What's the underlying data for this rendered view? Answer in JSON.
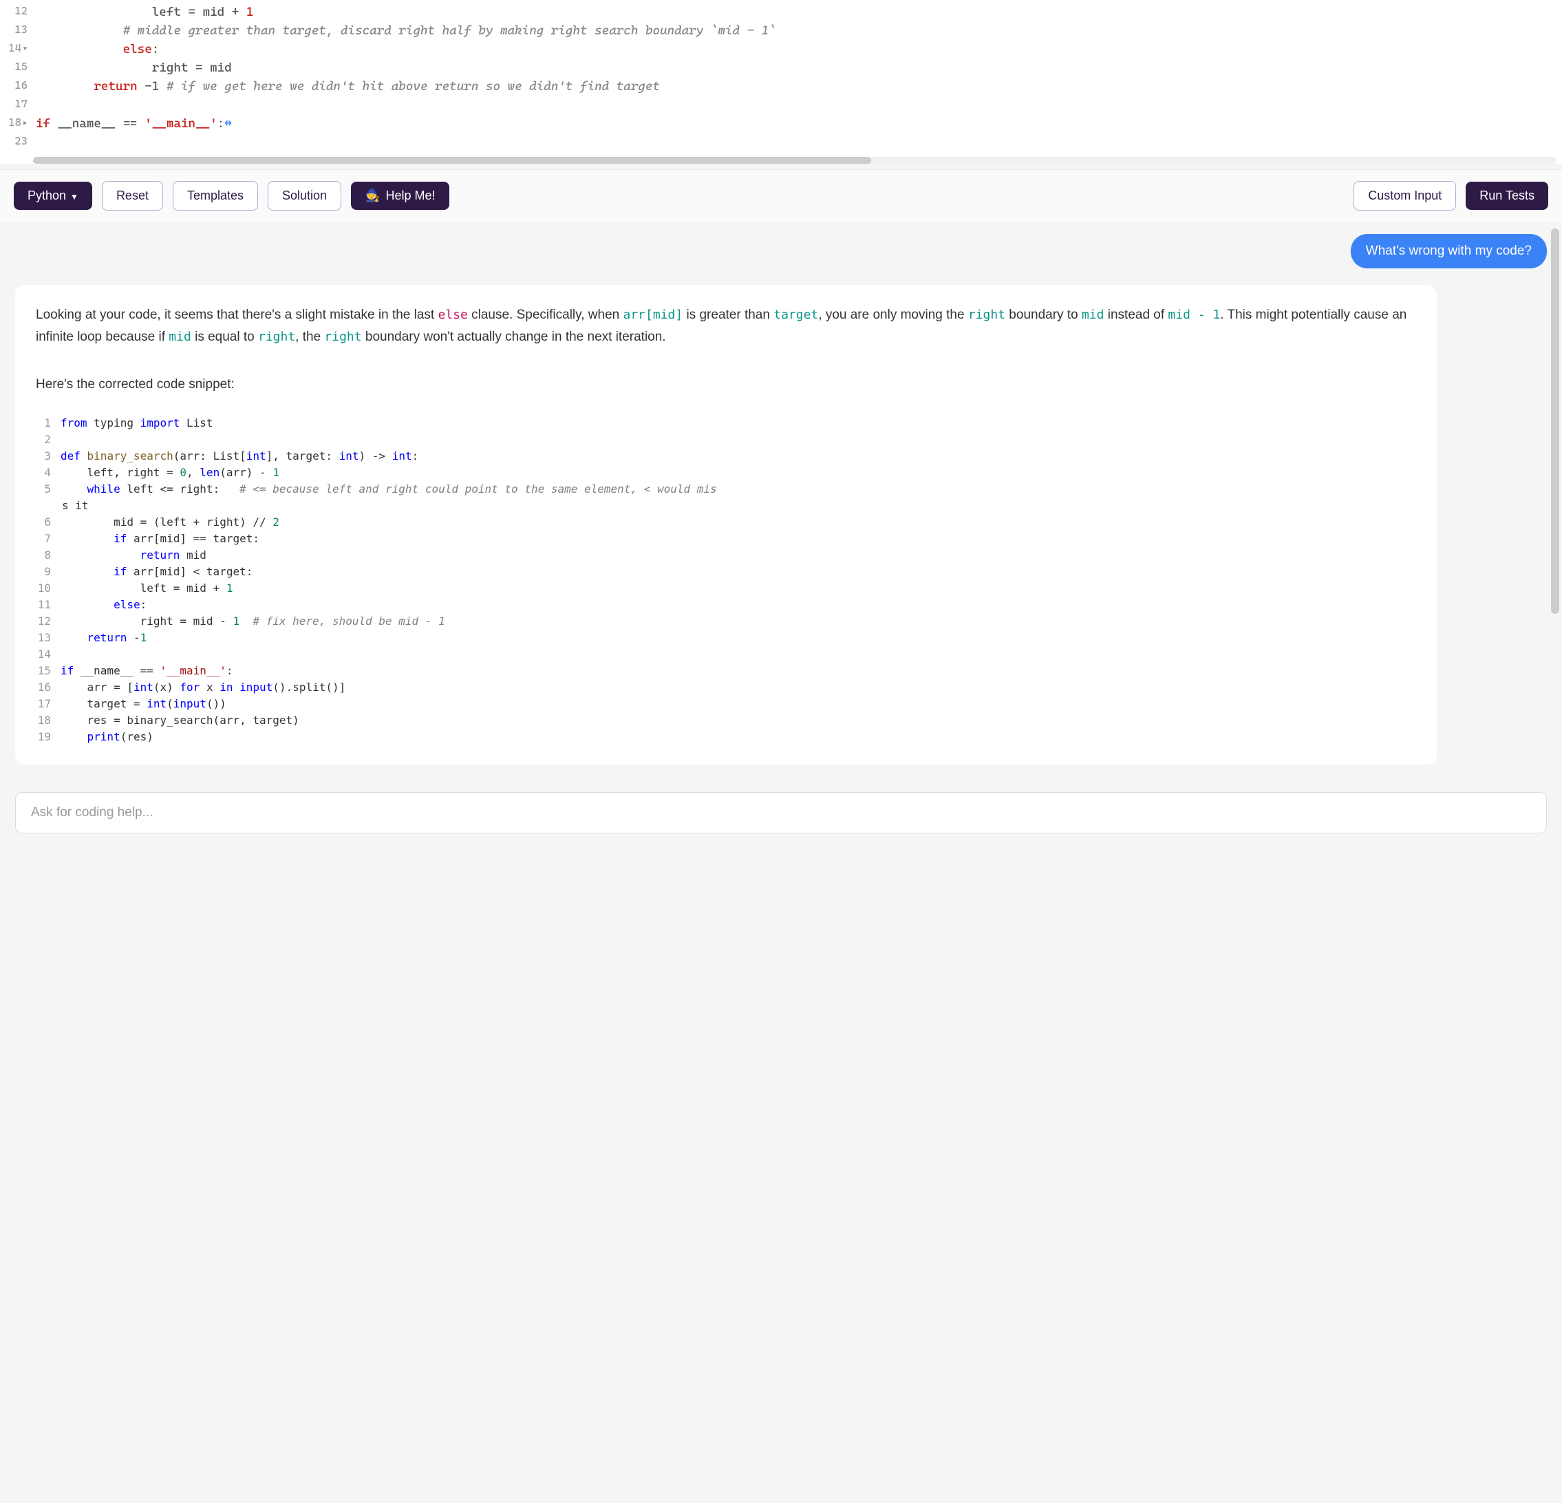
{
  "editor": {
    "lines": [
      {
        "n": 12,
        "marker": ""
      },
      {
        "n": 13,
        "marker": ""
      },
      {
        "n": 14,
        "marker": "▾"
      },
      {
        "n": 15,
        "marker": ""
      },
      {
        "n": 16,
        "marker": ""
      },
      {
        "n": 17,
        "marker": ""
      },
      {
        "n": 18,
        "marker": "▸"
      },
      {
        "n": 23,
        "marker": ""
      }
    ],
    "code": {
      "l12_indent": "                ",
      "l12_a": "left = mid + ",
      "l12_b": "1",
      "l13_indent": "            ",
      "l13": "# middle greater than target, discard right half by making right search boundary `mid - 1`",
      "l14_indent": "            ",
      "l14_a": "else",
      "l14_b": ":",
      "l15_indent": "                ",
      "l15": "right = mid",
      "l16_indent": "        ",
      "l16_a": "return",
      "l16_b": " -1 ",
      "l16_c": "# if we get here we didn't hit above return so we didn't find target",
      "l18_a": "if",
      "l18_b": " __name__ == ",
      "l18_c": "'__main__'",
      "l18_d": ":",
      "l18_fold": "↔"
    }
  },
  "toolbar": {
    "language": "Python",
    "reset": "Reset",
    "templates": "Templates",
    "solution": "Solution",
    "help": "Help Me!",
    "help_emoji": "🧙",
    "custom_input": "Custom Input",
    "run_tests": "Run Tests"
  },
  "chat": {
    "user_msg": "What's wrong with my code?",
    "expl_part1": "Looking at your code, it seems that there's a slight mistake in the last ",
    "expl_else": "else",
    "expl_part2": " clause. Specifically, when ",
    "expl_arrmid": "arr[mid]",
    "expl_part3": " is greater than ",
    "expl_target": "target",
    "expl_part4": ", you are only moving the ",
    "expl_right": "right",
    "expl_part5": " boundary to ",
    "expl_mid": "mid",
    "expl_part6": " instead of ",
    "expl_midm1": "mid - 1",
    "expl_part7": ". This might potentially cause an infinite loop because if ",
    "expl_mid2": "mid",
    "expl_part8": " is equal to ",
    "expl_right2": "right",
    "expl_part9": ", the ",
    "expl_right3": "right",
    "expl_part10": " boundary won't actually change in the next iteration.",
    "expl_snippet_intro": "Here's the corrected code snippet:",
    "snippet_lines": [
      "1",
      "2",
      "3",
      "4",
      "5",
      "",
      "6",
      "7",
      "8",
      "9",
      "10",
      "11",
      "12",
      "13",
      "14",
      "15",
      "16",
      "17",
      "18",
      "19"
    ],
    "snippet_wrap_text": "s it",
    "s1_a": "from",
    "s1_b": " typing ",
    "s1_c": "import",
    "s1_d": " List",
    "s3_a": "def",
    "s3_b": " binary_search",
    "s3_c": "(arr: List[",
    "s3_d": "int",
    "s3_e": "], target: ",
    "s3_f": "int",
    "s3_g": ") -> ",
    "s3_h": "int",
    "s3_i": ":",
    "s4_a": "    left, right = ",
    "s4_b": "0",
    "s4_c": ", ",
    "s4_d": "len",
    "s4_e": "(arr) - ",
    "s4_f": "1",
    "s5_a": "    ",
    "s5_b": "while",
    "s5_c": " left <= right:   ",
    "s5_d": "# <= because left and right could point to the same element, < would mis",
    "s6_a": "        mid = (left + right) // ",
    "s6_b": "2",
    "s7_a": "        ",
    "s7_b": "if",
    "s7_c": " arr[mid] == target:",
    "s8_a": "            ",
    "s8_b": "return",
    "s8_c": " mid",
    "s9_a": "        ",
    "s9_b": "if",
    "s9_c": " arr[mid] < target:",
    "s10_a": "            left = mid + ",
    "s10_b": "1",
    "s11_a": "        ",
    "s11_b": "else",
    "s11_c": ":",
    "s12_a": "            right = mid - ",
    "s12_b": "1",
    "s12_c": "  ",
    "s12_d": "# fix here, should be mid - 1",
    "s13_a": "    ",
    "s13_b": "return",
    "s13_c": " -",
    "s13_d": "1",
    "s15_a": "if",
    "s15_b": " __name__ == ",
    "s15_c": "'__main__'",
    "s15_d": ":",
    "s16_a": "    arr = [",
    "s16_b": "int",
    "s16_c": "(x) ",
    "s16_d": "for",
    "s16_e": " x ",
    "s16_f": "in",
    "s16_g": " ",
    "s16_h": "input",
    "s16_i": "().split()]",
    "s17_a": "    target = ",
    "s17_b": "int",
    "s17_c": "(",
    "s17_d": "input",
    "s17_e": "())",
    "s18_a": "    res = binary_search(arr, target)",
    "s19_a": "    ",
    "s19_b": "print",
    "s19_c": "(res)"
  },
  "input": {
    "placeholder": "Ask for coding help..."
  }
}
